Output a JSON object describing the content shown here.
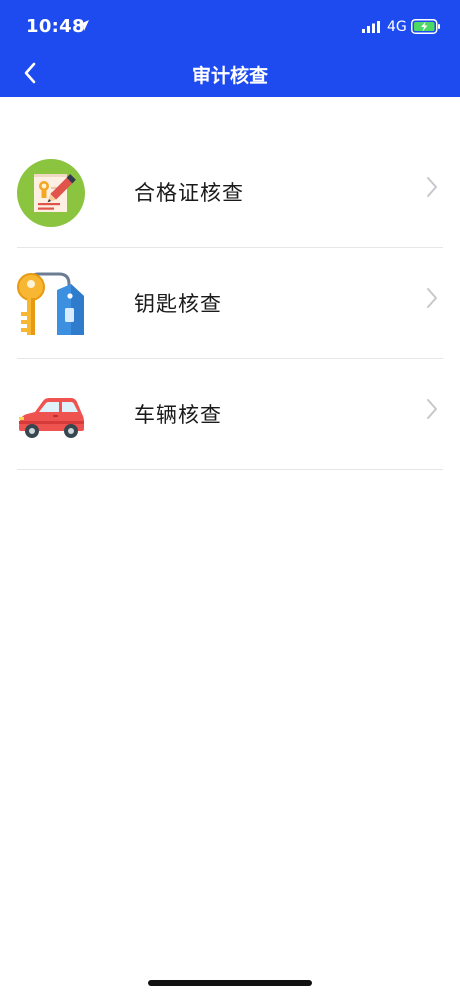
{
  "status_bar": {
    "time": "10:48",
    "network": "4G",
    "icons": [
      "location-arrow-icon",
      "signal-icon",
      "battery-charging-icon"
    ]
  },
  "navbar": {
    "title": "审计核查",
    "back_icon": "chevron-left-icon"
  },
  "menu": {
    "items": [
      {
        "label": "合格证核查",
        "icon": "certificate-icon"
      },
      {
        "label": "钥匙核查",
        "icon": "key-tag-icon"
      },
      {
        "label": "车辆核查",
        "icon": "car-icon"
      }
    ],
    "chevron_icon": "chevron-right-icon"
  },
  "colors": {
    "header_bg": "#1e4bf0",
    "divider": "#e6e6e6",
    "chevron": "#c7c7cc"
  }
}
